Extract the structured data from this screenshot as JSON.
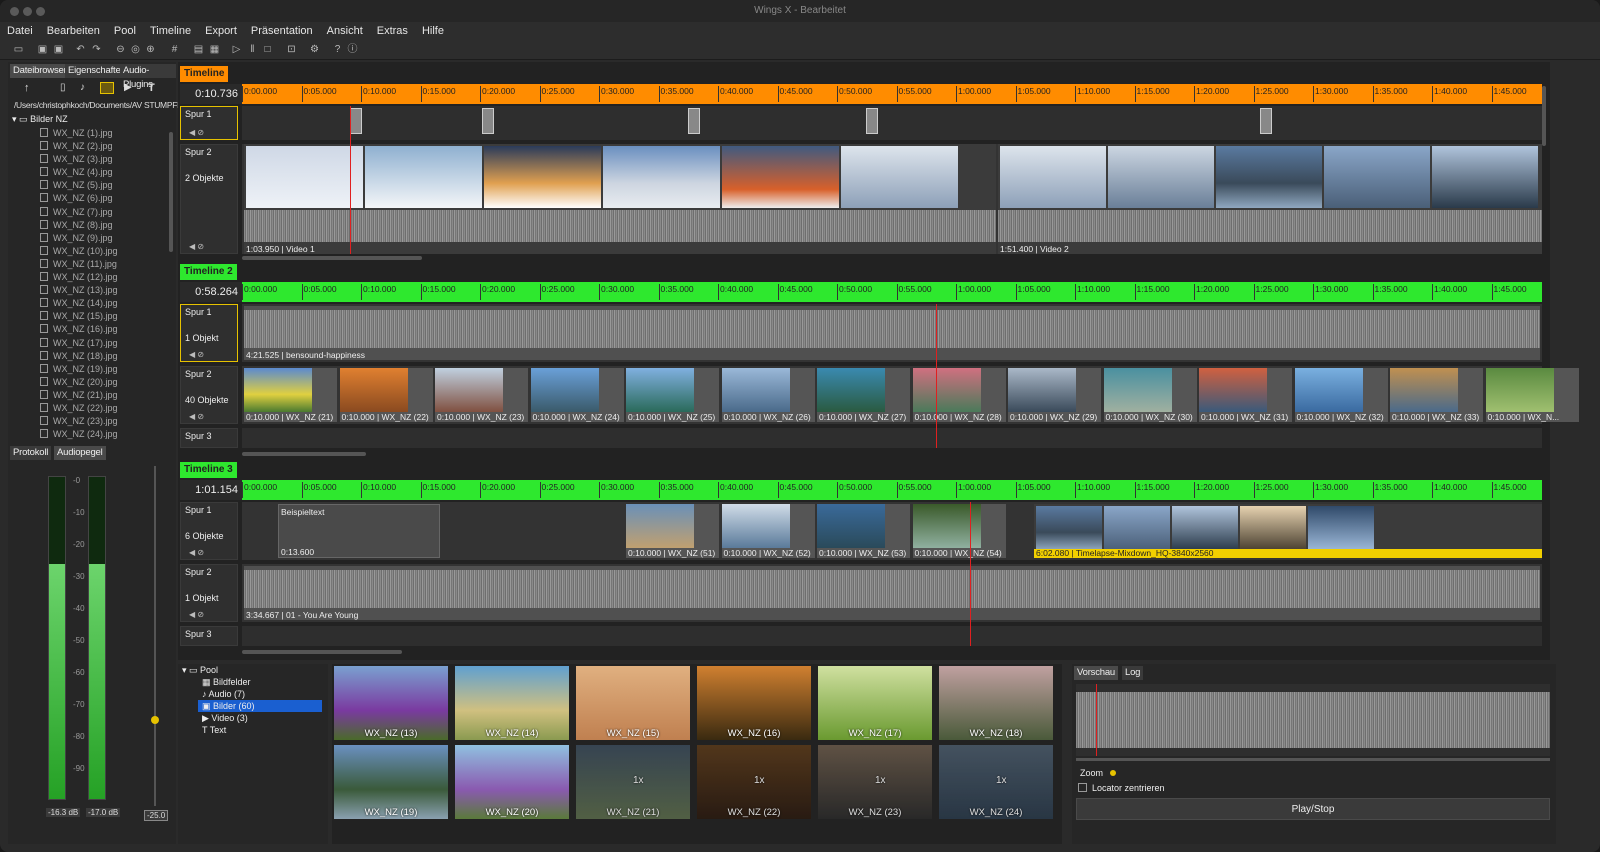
{
  "window": {
    "title": "Wings X - Bearbeitet"
  },
  "menu": [
    "Datei",
    "Bearbeiten",
    "Pool",
    "Timeline",
    "Export",
    "Präsentation",
    "Ansicht",
    "Extras",
    "Hilfe"
  ],
  "left_tabs": [
    "Dateibrowser",
    "Eigenschaften",
    "Audio-Plugins"
  ],
  "file_path": "/Users/christophkoch/Documents/AV STUMPFL/...",
  "folder": "Bilder NZ",
  "files": [
    "WX_NZ (1).jpg",
    "WX_NZ (2).jpg",
    "WX_NZ (3).jpg",
    "WX_NZ (4).jpg",
    "WX_NZ (5).jpg",
    "WX_NZ (6).jpg",
    "WX_NZ (7).jpg",
    "WX_NZ (8).jpg",
    "WX_NZ (9).jpg",
    "WX_NZ (10).jpg",
    "WX_NZ (11).jpg",
    "WX_NZ (12).jpg",
    "WX_NZ (13).jpg",
    "WX_NZ (14).jpg",
    "WX_NZ (15).jpg",
    "WX_NZ (16).jpg",
    "WX_NZ (17).jpg",
    "WX_NZ (18).jpg",
    "WX_NZ (19).jpg",
    "WX_NZ (20).jpg",
    "WX_NZ (21).jpg",
    "WX_NZ (22).jpg",
    "WX_NZ (23).jpg",
    "WX_NZ (24).jpg"
  ],
  "level_tabs": [
    "Protokoll",
    "Audiopegel"
  ],
  "db_scale": [
    "-0",
    "-10",
    "-20",
    "-30",
    "-40",
    "-50",
    "-60",
    "-70",
    "-80",
    "-90"
  ],
  "meters": {
    "left": "-16.3 dB",
    "right": "-17.0 dB",
    "left_level": 0.73,
    "right_level": 0.73,
    "master": "-25.0"
  },
  "ruler_ticks": [
    "0:00.000",
    "0:05.000",
    "0:10.000",
    "0:15.000",
    "0:20.000",
    "0:25.000",
    "0:30.000",
    "0:35.000",
    "0:40.000",
    "0:45.000",
    "0:50.000",
    "0:55.000",
    "1:00.000",
    "1:05.000",
    "1:10.000",
    "1:15.000",
    "1:20.000",
    "1:25.000",
    "1:30.000",
    "1:35.000",
    "1:40.000",
    "1:45.000"
  ],
  "timeline1": {
    "title": "Timeline",
    "time": "0:10.736",
    "color": "#ff8c00",
    "track1": {
      "name": "Spur 1"
    },
    "track2": {
      "name": "Spur 2",
      "count": "2 Objekte",
      "clip1": "1:03.950 | Video 1",
      "clip2": "1:51.400 | Video 2"
    }
  },
  "timeline2": {
    "title": "Timeline 2",
    "time": "0:58.264",
    "color": "#2ee82e",
    "track1": {
      "name": "Spur 1",
      "count": "1 Objekt",
      "clip": "4:21.525 | bensound-happiness"
    },
    "track2": {
      "name": "Spur 2",
      "count": "40 Objekte",
      "clips": [
        "0:10.000 | WX_NZ (21)",
        "0:10.000 | WX_NZ (22)",
        "0:10.000 | WX_NZ (23)",
        "0:10.000 | WX_NZ (24)",
        "0:10.000 | WX_NZ (25)",
        "0:10.000 | WX_NZ (26)",
        "0:10.000 | WX_NZ (27)",
        "0:10.000 | WX_NZ (28)",
        "0:10.000 | WX_NZ (29)",
        "0:10.000 | WX_NZ (30)",
        "0:10.000 | WX_NZ (31)",
        "0:10.000 | WX_NZ (32)",
        "0:10.000 | WX_NZ (33)",
        "0:10.000 | WX_N..."
      ]
    },
    "track3": {
      "name": "Spur 3"
    }
  },
  "timeline3": {
    "title": "Timeline 3",
    "time": "1:01.154",
    "color": "#2ee82e",
    "track1": {
      "name": "Spur 1",
      "count": "6 Objekte",
      "text_clip": "Beispieltext",
      "text_dur": "0:13.600",
      "clips": [
        "0:10.000 | WX_NZ (51)",
        "0:10.000 | WX_NZ (52)",
        "0:10.000 | WX_NZ (53)",
        "0:10.000 | WX_NZ (54)"
      ],
      "video_clip": "6:02.080 | Timelapse-Mixdown_HQ-3840x2560"
    },
    "track2": {
      "name": "Spur 2",
      "count": "1 Objekt",
      "clip": "3:34.667 | 01 - You Are Young"
    },
    "track3": {
      "name": "Spur 3"
    }
  },
  "pool": {
    "root": "Pool",
    "items": [
      "Bildfelder",
      "Audio (7)",
      "Bilder (60)",
      "Video (3)",
      "Text"
    ],
    "selected": 2
  },
  "pool_tiles": [
    {
      "label": "WX_NZ (13)",
      "mult": ""
    },
    {
      "label": "WX_NZ (14)",
      "mult": ""
    },
    {
      "label": "WX_NZ (15)",
      "mult": ""
    },
    {
      "label": "WX_NZ (16)",
      "mult": ""
    },
    {
      "label": "WX_NZ (17)",
      "mult": ""
    },
    {
      "label": "WX_NZ (18)",
      "mult": ""
    },
    {
      "label": "WX_NZ (19)",
      "mult": ""
    },
    {
      "label": "WX_NZ (20)",
      "mult": ""
    },
    {
      "label": "WX_NZ (21)",
      "mult": "1x"
    },
    {
      "label": "WX_NZ (22)",
      "mult": "1x"
    },
    {
      "label": "WX_NZ (23)",
      "mult": "1x"
    },
    {
      "label": "WX_NZ (24)",
      "mult": "1x"
    }
  ],
  "preview": {
    "tabs": [
      "Vorschau",
      "Log"
    ],
    "zoom": "Zoom",
    "center": "Locator zentrieren",
    "play": "Play/Stop"
  }
}
